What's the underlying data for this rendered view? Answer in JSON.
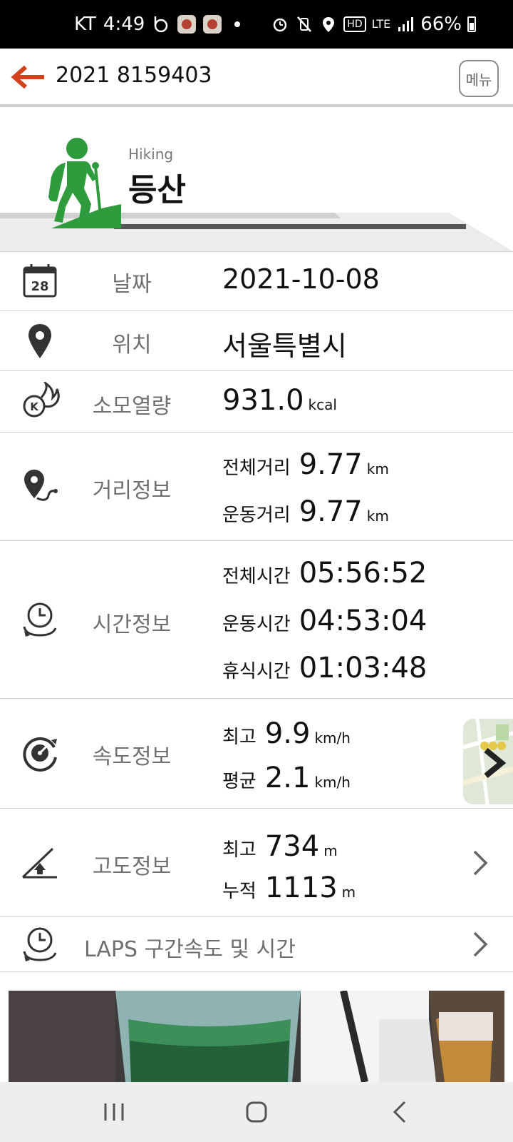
{
  "status_bar": {
    "carrier": "KT",
    "time": "4:49",
    "battery": "66%",
    "network": "LTE",
    "hd_badge": "HD"
  },
  "app_bar": {
    "title": "2021 8159403",
    "menu_label": "메뉴"
  },
  "header": {
    "activity_en": "Hiking",
    "activity_ko": "등산",
    "accent_color": "#2e9c3c"
  },
  "rows": {
    "date": {
      "label": "날짜",
      "value": "2021-10-08",
      "icon_day": "28"
    },
    "location": {
      "label": "위치",
      "value": "서울특별시"
    },
    "calories": {
      "label": "소모열량",
      "value": "931.0",
      "unit": "kcal"
    },
    "distance": {
      "label": "거리정보",
      "total_label": "전체거리",
      "total_value": "9.77",
      "total_unit": "km",
      "exercise_label": "운동거리",
      "exercise_value": "9.77",
      "exercise_unit": "km"
    },
    "time": {
      "label": "시간정보",
      "total_label": "전체시간",
      "total_value": "05:56:52",
      "exercise_label": "운동시간",
      "exercise_value": "04:53:04",
      "rest_label": "휴식시간",
      "rest_value": "01:03:48"
    },
    "speed": {
      "label": "속도정보",
      "max_label": "최고",
      "max_value": "9.9",
      "max_unit": "km/h",
      "avg_label": "평균",
      "avg_value": "2.1",
      "avg_unit": "km/h"
    },
    "altitude": {
      "label": "고도정보",
      "max_label": "최고",
      "max_value": "734",
      "max_unit": "m",
      "cum_label": "누적",
      "cum_value": "1113",
      "cum_unit": "m"
    },
    "laps": {
      "label": "LAPS 구간속도 및 시간"
    }
  },
  "icons": {
    "back": "back-arrow-icon",
    "calendar": "calendar-icon",
    "location": "location-pin-icon",
    "calories": "calorie-flame-icon",
    "distance": "distance-route-icon",
    "time": "clock-icon",
    "speed": "speedometer-icon",
    "altitude": "altitude-angle-icon",
    "laps": "laps-clock-icon"
  },
  "colors": {
    "back_arrow": "#d2401c",
    "label_gray": "#6f6f6f",
    "divider": "#cfcfcf"
  }
}
